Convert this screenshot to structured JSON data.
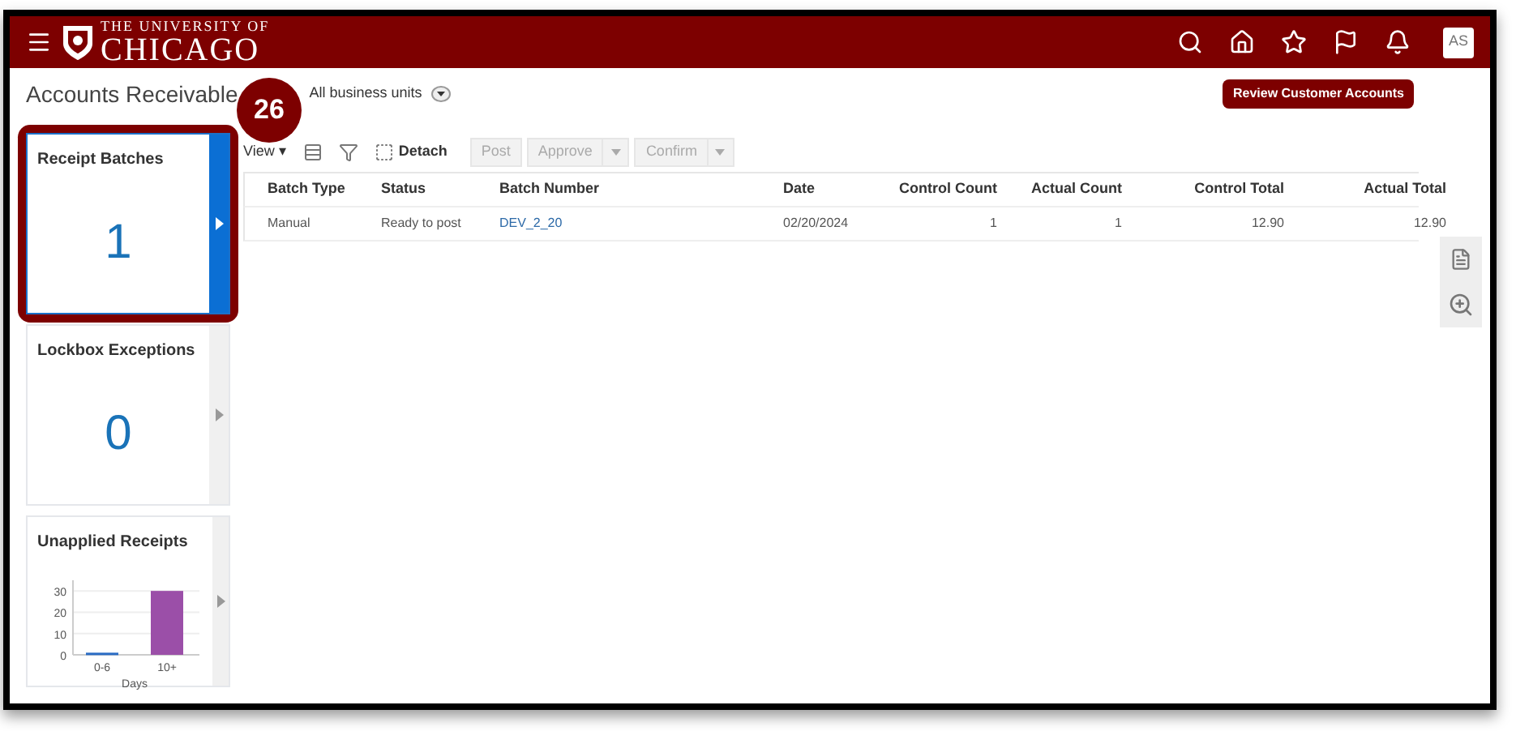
{
  "header": {
    "logo_top": "THE UNIVERSITY OF",
    "logo_bottom": "CHICAGO",
    "avatar": "AS"
  },
  "page": {
    "title": "Accounts Receivable",
    "business_unit": "All business units",
    "action_button": "Review Customer Accounts"
  },
  "callout": {
    "label": "26"
  },
  "tiles": [
    {
      "kind": "count",
      "title": "Receipt Batches",
      "value": "1",
      "selected": true
    },
    {
      "kind": "count",
      "title": "Lockbox Exceptions",
      "value": "0",
      "selected": false
    },
    {
      "kind": "chart",
      "title": "Unapplied Receipts",
      "selected": false,
      "chart_data": {
        "type": "bar",
        "xlabel": "Days",
        "categories": [
          "0-6",
          "10+"
        ],
        "grid": true,
        "series": [
          {
            "colors": [
              "#2b6cc4",
              "#9b4fa8"
            ],
            "values": [
              1,
              30
            ]
          }
        ],
        "ylim": [
          0,
          35
        ],
        "yticks": [
          0,
          10,
          20,
          30
        ]
      }
    }
  ],
  "toolbar": {
    "view": "View",
    "view_caret": "▾",
    "detach": "Detach",
    "buttons": [
      {
        "label": "Post",
        "menu": false,
        "disabled": true
      },
      {
        "label": "Approve",
        "menu": true,
        "disabled": true
      },
      {
        "label": "Confirm",
        "menu": true,
        "disabled": true
      }
    ]
  },
  "table": {
    "columns": [
      {
        "label": "Batch Type",
        "kind": "text"
      },
      {
        "label": "Status",
        "kind": "text"
      },
      {
        "label": "Batch Number",
        "kind": "link"
      },
      {
        "label": "Date",
        "kind": "text"
      },
      {
        "label": "Control Count",
        "kind": "number"
      },
      {
        "label": "Actual Count",
        "kind": "number"
      },
      {
        "label": "Control Total",
        "kind": "number"
      },
      {
        "label": "Actual Total",
        "kind": "number"
      }
    ],
    "rows": [
      {
        "cells": [
          "Manual",
          "Ready to post",
          "DEV_2_20",
          "02/20/2024",
          "1",
          "1",
          "12.90",
          "12.90"
        ]
      }
    ]
  }
}
